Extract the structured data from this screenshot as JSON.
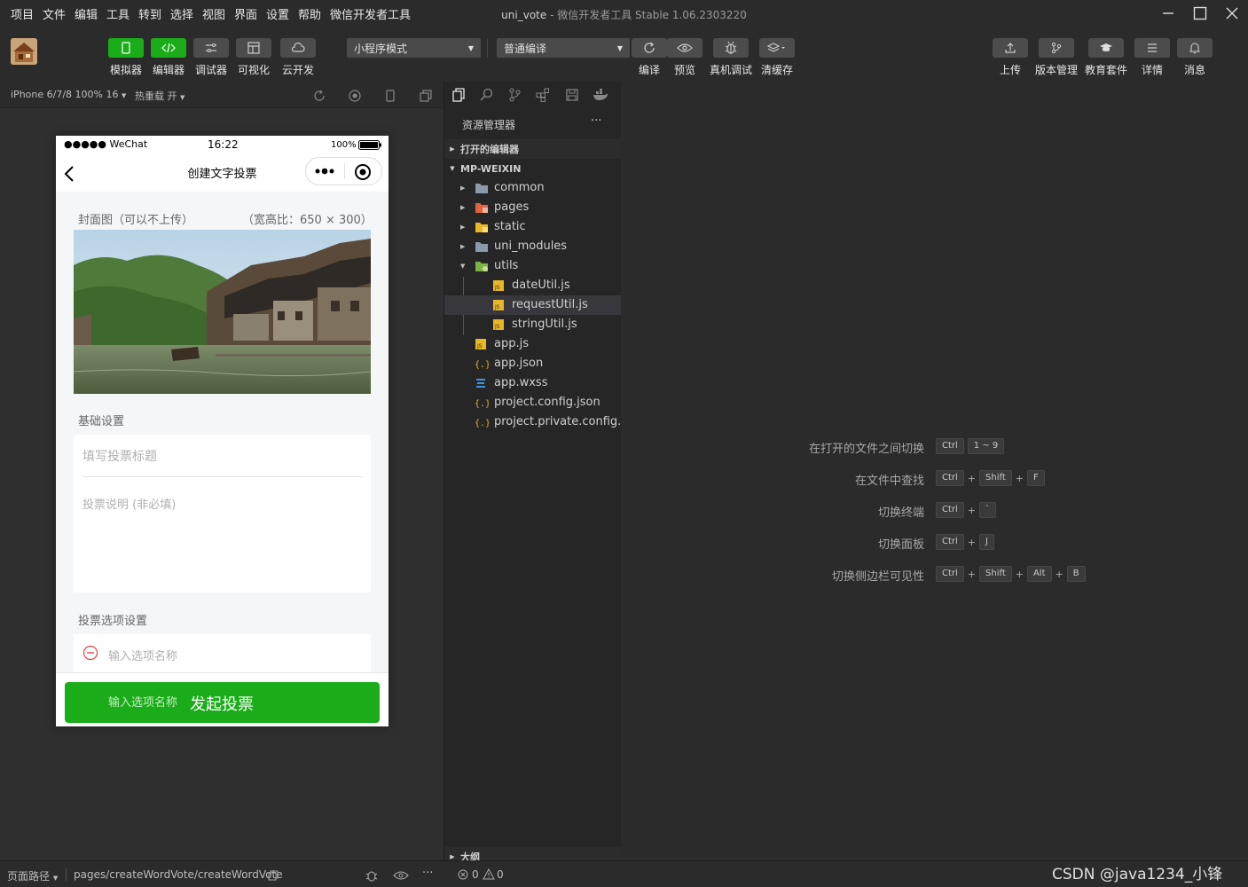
{
  "window": {
    "title_project": "uni_vote",
    "title_rest": " - 微信开发者工具 Stable 1.06.2303220",
    "menu": [
      "项目",
      "文件",
      "编辑",
      "工具",
      "转到",
      "选择",
      "视图",
      "界面",
      "设置",
      "帮助",
      "微信开发者工具"
    ]
  },
  "toolbar": {
    "left_buttons": [
      {
        "label": "模拟器",
        "icon": "phone-icon"
      },
      {
        "label": "编辑器",
        "icon": "code-icon"
      },
      {
        "label": "调试器",
        "icon": "debug-icon"
      },
      {
        "label": "可视化",
        "icon": "layout-icon"
      },
      {
        "label": "云开发",
        "icon": "cloud-icon"
      }
    ],
    "mode_select": "小程序模式",
    "compile_select": "普通编译",
    "mid_buttons": [
      {
        "label": "编译",
        "icon": "refresh-icon"
      },
      {
        "label": "预览",
        "icon": "eye-icon"
      },
      {
        "label": "真机调试",
        "icon": "bug-icon"
      },
      {
        "label": "清缓存",
        "icon": "layers-icon"
      }
    ],
    "right_buttons": [
      {
        "label": "上传",
        "icon": "upload-icon"
      },
      {
        "label": "版本管理",
        "icon": "branch-icon"
      },
      {
        "label": "教育套件",
        "icon": "graduation-cap-icon"
      },
      {
        "label": "详情",
        "icon": "list-icon"
      },
      {
        "label": "消息",
        "icon": "bell-icon"
      }
    ]
  },
  "simulator": {
    "device": "iPhone 6/7/8 100% 16",
    "hot_reload": "热重载 开"
  },
  "phone": {
    "carrier": "●●●●● WeChat",
    "time": "16:22",
    "battery": "100%",
    "nav_title": "创建文字投票",
    "cover_label": "封面图（可以不上传）",
    "cover_ratio": "（宽高比：650 × 300）",
    "basic_label": "基础设置",
    "title_placeholder": "填写投票标题",
    "desc_placeholder": "投票说明 (非必填)",
    "options_label": "投票选项设置",
    "option_placeholder": "输入选项名称",
    "submit_ghost": "输入选项名称",
    "submit_label": "发起投票"
  },
  "explorer": {
    "header": "资源管理器",
    "more": "···",
    "open_editors": "打开的编辑器",
    "root": "MP-WEIXIN",
    "outline": "大纲",
    "items": [
      {
        "name": "common",
        "type": "folder",
        "depth": 1,
        "expanded": false
      },
      {
        "name": "pages",
        "type": "folder-pages",
        "depth": 1,
        "expanded": false
      },
      {
        "name": "static",
        "type": "folder-static",
        "depth": 1,
        "expanded": false
      },
      {
        "name": "uni_modules",
        "type": "folder",
        "depth": 1,
        "expanded": false
      },
      {
        "name": "utils",
        "type": "folder-utils",
        "depth": 1,
        "expanded": true
      },
      {
        "name": "dateUtil.js",
        "type": "js",
        "depth": 2
      },
      {
        "name": "requestUtil.js",
        "type": "js",
        "depth": 2,
        "selected": true
      },
      {
        "name": "stringUtil.js",
        "type": "js",
        "depth": 2
      },
      {
        "name": "app.js",
        "type": "js",
        "depth": 1
      },
      {
        "name": "app.json",
        "type": "json",
        "depth": 1
      },
      {
        "name": "app.wxss",
        "type": "css",
        "depth": 1
      },
      {
        "name": "project.config.json",
        "type": "json",
        "depth": 1
      },
      {
        "name": "project.private.config.js...",
        "type": "json",
        "depth": 1
      }
    ]
  },
  "shortcuts": [
    {
      "label": "在打开的文件之间切换",
      "keys": [
        "Ctrl",
        "1 ~ 9"
      ],
      "joined": false
    },
    {
      "label": "在文件中查找",
      "keys": [
        "Ctrl",
        "Shift",
        "F"
      ],
      "joined": true
    },
    {
      "label": "切换终端",
      "keys": [
        "Ctrl",
        "`"
      ],
      "joined": true
    },
    {
      "label": "切换面板",
      "keys": [
        "Ctrl",
        "J"
      ],
      "joined": true
    },
    {
      "label": "切换侧边栏可见性",
      "keys": [
        "Ctrl",
        "Shift",
        "Alt",
        "B"
      ],
      "joined": true
    }
  ],
  "status": {
    "page_path_label": "页面路径",
    "page_path": "pages/createWordVote/createWordVote",
    "errors": "0",
    "warnings": "0",
    "watermark": "CSDN @java1234_小锋"
  },
  "colors": {
    "accent_green": "#1aad19",
    "bg": "#2b2b2b",
    "explorer_bg": "#262626"
  }
}
